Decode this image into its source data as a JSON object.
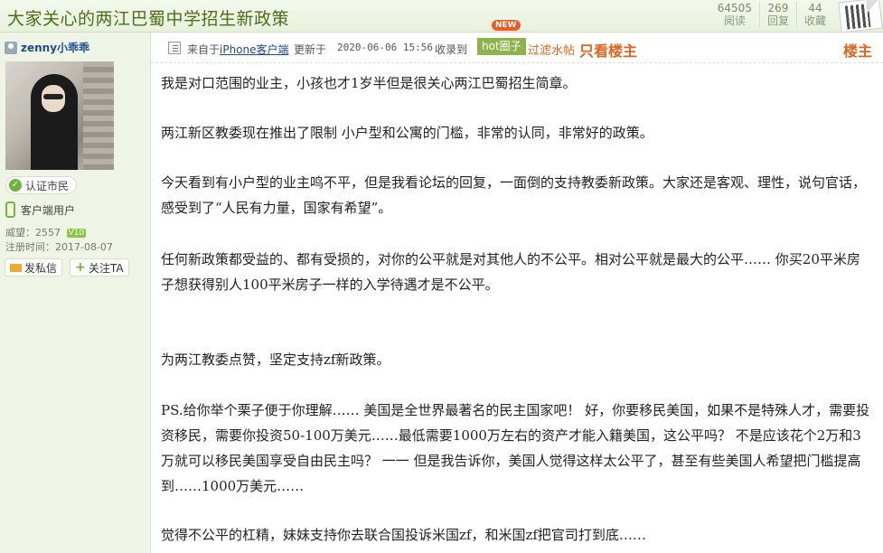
{
  "title": "大家关心的两江巴蜀中学招生新政策",
  "stats": [
    {
      "num": "64505",
      "label": "阅读"
    },
    {
      "num": "269",
      "label": "回复"
    },
    {
      "num": "44",
      "label": "收藏"
    }
  ],
  "author": {
    "username": "zenny小乖乖",
    "cert_label": "认证市民",
    "client_label": "客户端用户",
    "prestige_label": "威望：2557",
    "level": "10",
    "reg_label": "注册时间：2017-08-07",
    "msg_button": "发私信",
    "follow_button": "关注TA"
  },
  "post_header": {
    "from_text": "来自于",
    "source": "iPhone客户端",
    "updated_label": "更新于",
    "updated_time": "2020-06-06 15:56",
    "collected_label": "收录到",
    "hot_tag": "hot圈子",
    "new_badge": "NEW",
    "filter_link": "过滤水帖",
    "only_host": "只看楼主",
    "floor": "楼主"
  },
  "body": {
    "p1": "我是对口范围的业主，小孩也才1岁半但是很关心两江巴蜀招生简章。",
    "p2": "两江新区教委现在推出了限制 小户型和公寓的门槛，非常的认同，非常好的政策。",
    "p3": "今天看到有小户型的业主鸣不平，但是我看论坛的回复，一面倒的支持教委新政策。大家还是客观、理性，说句官话，感受到了“人民有力量，国家有希望”。",
    "p4": "任何新政策都受益的、都有受损的，对你的公平就是对其他人的不公平。相对公平就是最大的公平…… 你买20平米房子想获得别人100平米房子一样的入学待遇才是不公平。",
    "p5": "为两江教委点赞，坚定支持zf新政策。",
    "p6": "PS.给你举个栗子便于你理解…… 美国是全世界最著名的民主国家吧！ 好，你要移民美国，如果不是特殊人才，需要投资移民，需要你投资50-100万美元……最低需要1000万左右的资产才能入籍美国，这公平吗？ 不是应该花个2万和3万就可以移民美国享受自由民主吗？ 一一 但是我告诉你，美国人觉得这样太公平了，甚至有些美国人希望把门槛提高到……1000万美元……",
    "p7": "觉得不公平的杠精，妹妹支持你去联合国投诉米国zf，和米国zf把官司打到底……"
  }
}
